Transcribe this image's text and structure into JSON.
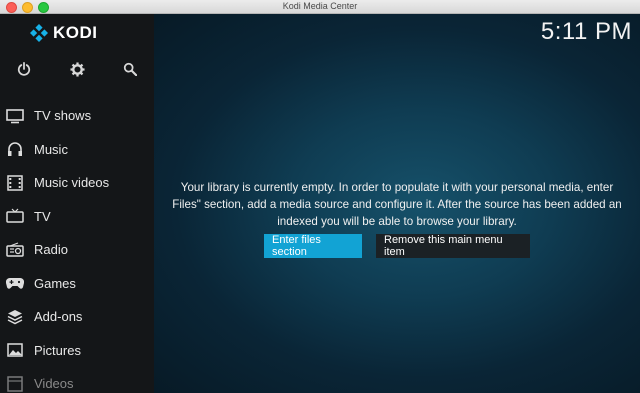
{
  "window": {
    "title": "Kodi Media Center"
  },
  "brand": {
    "name": "KODI"
  },
  "clock": {
    "time": "5:11 PM"
  },
  "top_icons": [
    "power-icon",
    "gear-icon",
    "search-icon"
  ],
  "menu": [
    {
      "label": "TV shows",
      "icon": "monitor-icon"
    },
    {
      "label": "Music",
      "icon": "headphones-icon"
    },
    {
      "label": "Music videos",
      "icon": "film-icon"
    },
    {
      "label": "TV",
      "icon": "tv-icon"
    },
    {
      "label": "Radio",
      "icon": "radio-icon"
    },
    {
      "label": "Games",
      "icon": "gamepad-icon"
    },
    {
      "label": "Add-ons",
      "icon": "box-icon"
    },
    {
      "label": "Pictures",
      "icon": "picture-icon"
    },
    {
      "label": "Videos",
      "icon": "video-icon"
    }
  ],
  "main": {
    "message_lines": [
      "Your library is currently empty. In order to populate it with your personal media, enter",
      "Files\" section, add a media source and configure it. After the source has been added an",
      "indexed you will be able to browse your library."
    ],
    "enter_files_label": "Enter files section",
    "remove_item_label": "Remove this main menu item"
  },
  "colors": {
    "accent": "#12a3d4",
    "sidebar": "#141618",
    "background": "#0f3c52"
  }
}
